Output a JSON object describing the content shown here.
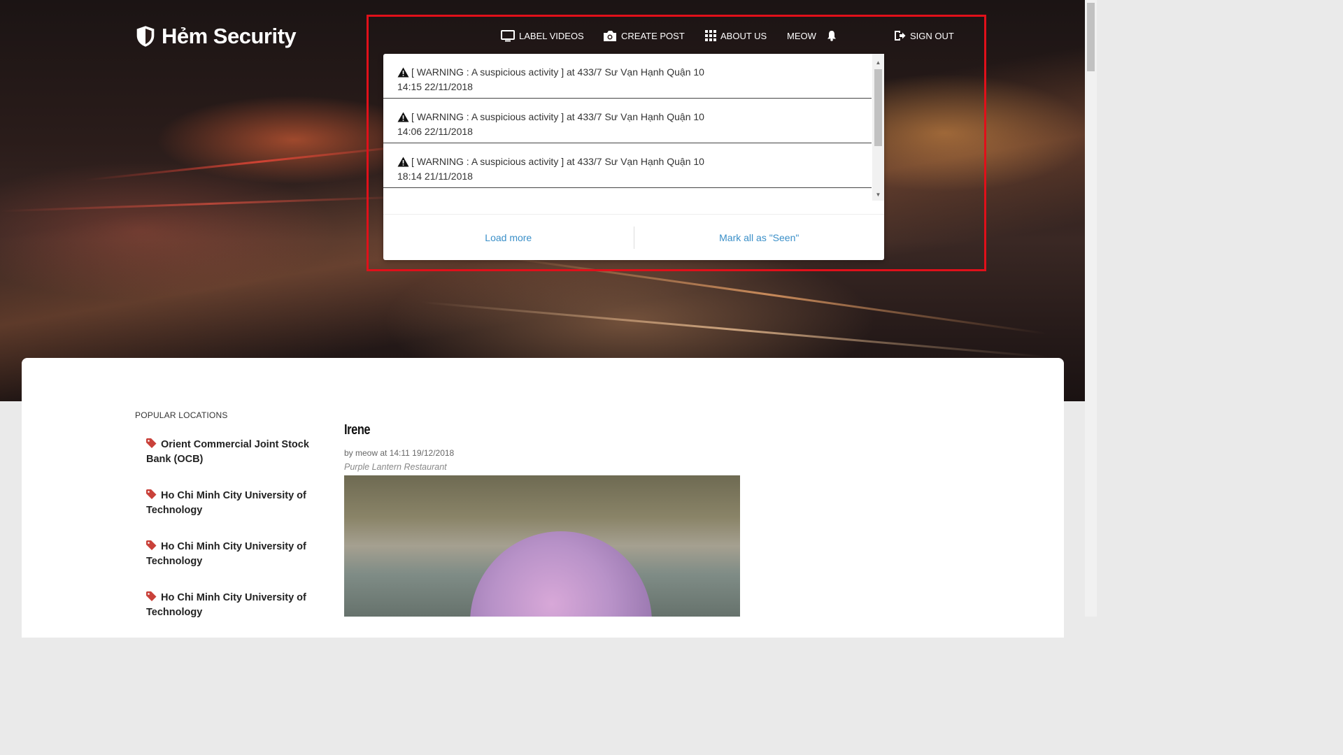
{
  "brand": {
    "name": "Hẻm Security",
    "icon": "shield-icon"
  },
  "nav": {
    "label_videos": "LABEL VIDEOS",
    "create_post": "CREATE POST",
    "about_us": "ABOUT US",
    "user": "MEOW",
    "sign_out": "SIGN OUT"
  },
  "notifications": {
    "items": [
      {
        "message": "[ WARNING : A suspicious activity ] at 433/7 Sư Vạn Hạnh Quận 10",
        "time": "14:15 22/11/2018"
      },
      {
        "message": "[ WARNING : A suspicious activity ] at 433/7 Sư Vạn Hạnh Quận 10",
        "time": "14:06 22/11/2018"
      },
      {
        "message": "[ WARNING : A suspicious activity ] at 433/7 Sư Vạn Hạnh Quận 10",
        "time": "18:14 21/11/2018"
      }
    ],
    "load_more": "Load more",
    "mark_seen": "Mark all as \"Seen\""
  },
  "sidebar": {
    "title": "POPULAR LOCATIONS",
    "locations": [
      "Orient Commercial Joint Stock Bank (OCB)",
      "Ho Chi Minh City University of Technology",
      "Ho Chi Minh City University of Technology",
      "Ho Chi Minh City University of Technology"
    ]
  },
  "post": {
    "title": "Irene",
    "meta": "by meow at 14:11 19/12/2018",
    "place": "Purple Lantern Restaurant"
  },
  "colors": {
    "highlight": "#e0101a",
    "link": "#3a8fc8",
    "tag": "#c9413a"
  }
}
